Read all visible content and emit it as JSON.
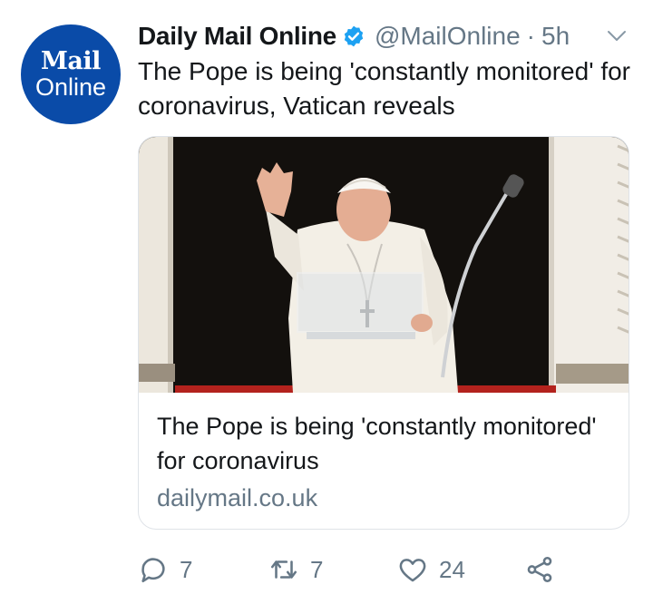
{
  "tweet": {
    "avatar": {
      "line1": "Mail",
      "line2": "Online",
      "color": "#0a4ba8"
    },
    "author": {
      "name": "Daily Mail Online",
      "handle": "@MailOnline",
      "separator": "·",
      "time": "5h",
      "verified": true
    },
    "menu_icon": "chevron-down-icon",
    "text": "The Pope is being 'constantly monitored' for coronavirus, Vatican reveals",
    "card": {
      "image": "pope-waving-photo",
      "title": "The Pope is being 'constantly monitored' for coronavirus",
      "domain": "dailymail.co.uk"
    },
    "actions": {
      "reply": {
        "icon": "reply-icon",
        "count": "7"
      },
      "retweet": {
        "icon": "retweet-icon",
        "count": "7"
      },
      "like": {
        "icon": "heart-icon",
        "count": "24"
      },
      "share": {
        "icon": "share-icon"
      }
    }
  },
  "colors": {
    "secondary_text": "#657786",
    "verified_blue": "#1da1f2",
    "border": "#dfe3e8"
  }
}
